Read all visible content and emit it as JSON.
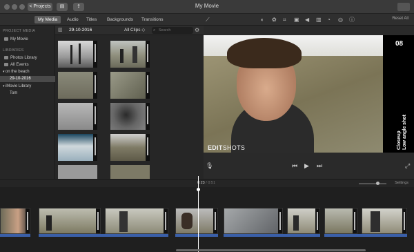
{
  "window": {
    "title": "My Movie",
    "back_label": "< Projects"
  },
  "toolbar": {
    "tabs": [
      {
        "label": "My Media",
        "active": true
      },
      {
        "label": "Audio"
      },
      {
        "label": "Titles"
      },
      {
        "label": "Backgrounds"
      },
      {
        "label": "Transitions"
      }
    ],
    "reset_all": "Reset All"
  },
  "sidebar": {
    "project_media_heading": "PROJECT MEDIA",
    "project_item": "My Movie",
    "libraries_heading": "LIBRARIES",
    "items": [
      {
        "label": "Photos Library"
      },
      {
        "label": "All Events"
      },
      {
        "label": "on the beach"
      },
      {
        "label": "29-10-2016",
        "selected": true
      },
      {
        "label": "iMovie Library"
      },
      {
        "label": "Tom"
      }
    ]
  },
  "browser": {
    "date": "29-10-2016",
    "filter": "All Clips ◇",
    "search_placeholder": "Search"
  },
  "viewer": {
    "shot_number": "08",
    "shot_line1": "Closeup",
    "shot_line2": "Low angle shot",
    "watermark_bold": "EDIT",
    "watermark_light": "SHOTS"
  },
  "timeline": {
    "timecode_current": "0:23",
    "timecode_sep": " / ",
    "timecode_total": "0:51",
    "settings_label": "Settings"
  },
  "icons": {
    "enhance": "magic-wand-icon",
    "color_balance": "color-balance-icon",
    "color_correction": "color-palette-icon",
    "crop": "crop-icon",
    "stabilize": "camera-icon",
    "volume": "speaker-icon",
    "noise": "equalizer-icon",
    "speed": "speedometer-icon",
    "filter": "filter-icon",
    "info": "info-icon"
  }
}
